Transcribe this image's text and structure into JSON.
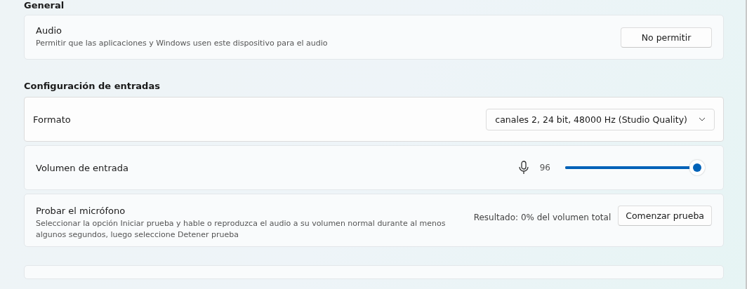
{
  "sections": [
    {
      "heading": "General",
      "cards": [
        {
          "kind": "button",
          "title": "Audio",
          "description": "Permitir que las aplicaciones y Windows usen este dispositivo para el audio",
          "button": "No permitir"
        }
      ]
    },
    {
      "heading": "Configuración de entradas",
      "cards": [
        {
          "kind": "dropdown",
          "title": "Formato",
          "value": "canales 2, 24 bit, 48000 Hz (Studio Quality)"
        },
        {
          "kind": "slider",
          "title": "Volumen de entrada",
          "reading": "96",
          "level": 0.96
        },
        {
          "kind": "test",
          "title": "Probar el micrófono",
          "description": "Seleccionar la opción Iniciar prueba y hable o reproduzca el audio a su volumen normal durante al menos algunos segundos, luego seleccione Detener prueba",
          "result": "Resultado: 0% del volumen total",
          "button": "Comenzar prueba"
        }
      ]
    }
  ]
}
